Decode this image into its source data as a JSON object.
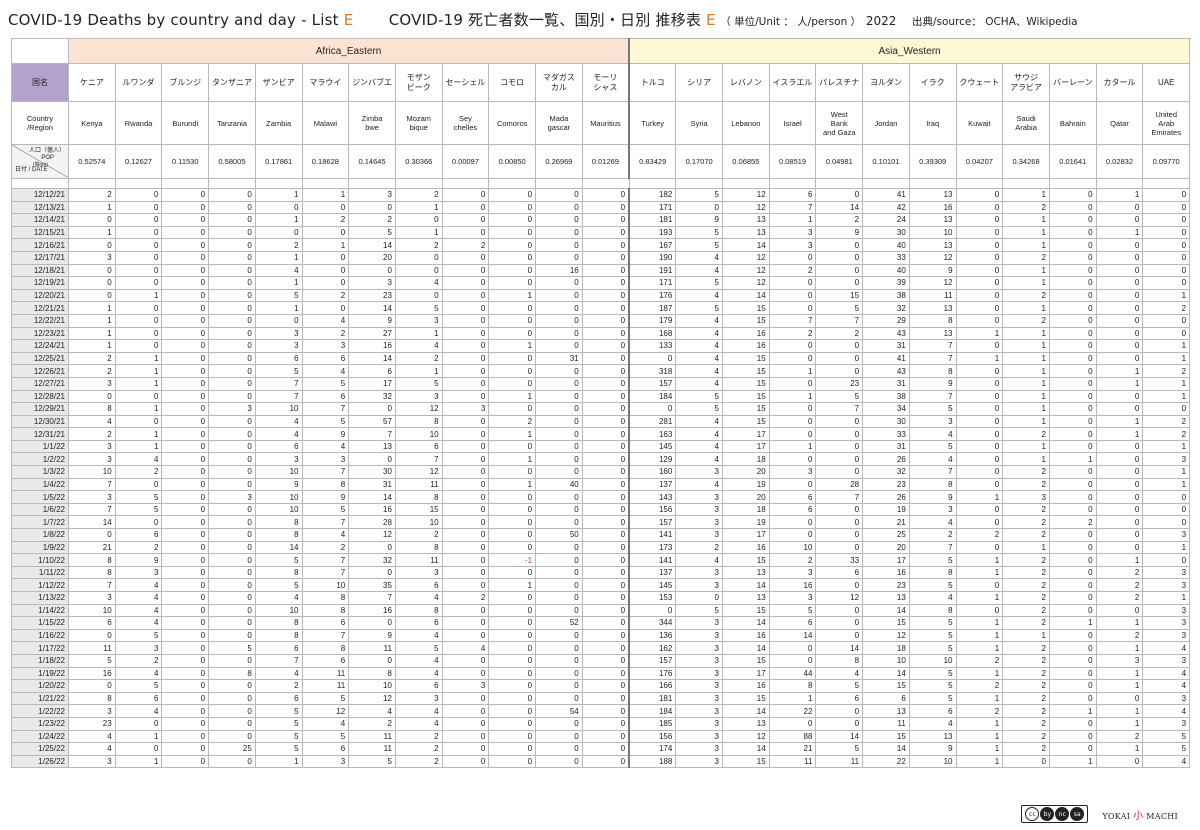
{
  "header": {
    "title_en_a": "COVID-19 Deaths by country and day - List ",
    "title_en_b": "E",
    "title_jp_a": "COVID-19  死亡者数一覧、国別・日別 推移表 ",
    "title_jp_b": "E",
    "unit": "（ 単位/Unit ： 人/person ）",
    "year": "2022",
    "source": "出典/source： OCHA、Wikipedia"
  },
  "regions": [
    {
      "name": "Africa_Eastern",
      "span": 12
    },
    {
      "name": "Asia_Western",
      "span": 13
    }
  ],
  "labels": {
    "country_jp": "国名",
    "country_en": "Country\n/Region",
    "pop_a": "人口（億人）",
    "pop_b": "POP",
    "pop_unit": "(億nm)",
    "date": "日付 / DATE"
  },
  "countries": [
    {
      "jp": "ケニア",
      "en": "Kenya",
      "pop": "0.52574"
    },
    {
      "jp": "ルワンダ",
      "en": "Rwanda",
      "pop": "0.12627"
    },
    {
      "jp": "ブルンジ",
      "en": "Burundi",
      "pop": "0.11530"
    },
    {
      "jp": "タンザニア",
      "en": "Tanzania",
      "pop": "0.58005"
    },
    {
      "jp": "ザンビア",
      "en": "Zambia",
      "pop": "0.17861"
    },
    {
      "jp": "マラウイ",
      "en": "Malawi",
      "pop": "0.18628"
    },
    {
      "jp": "ジンバブエ",
      "en": "Zimba\nbwe",
      "pop": "0.14645"
    },
    {
      "jp": "モザン\nビーク",
      "en": "Mozam\nbique",
      "pop": "0.30366"
    },
    {
      "jp": "セーシェル",
      "en": "Sey\nchelles",
      "pop": "0.00097"
    },
    {
      "jp": "コモロ",
      "en": "Comoros",
      "pop": "0.00850"
    },
    {
      "jp": "マダガス\nカル",
      "en": "Mada\ngascar",
      "pop": "0.26969"
    },
    {
      "jp": "モーリ\nシャス",
      "en": "Mauritius",
      "pop": "0.01269"
    },
    {
      "jp": "トルコ",
      "en": "Turkey",
      "pop": "0.83429"
    },
    {
      "jp": "シリア",
      "en": "Syria",
      "pop": "0.17070"
    },
    {
      "jp": "レバノン",
      "en": "Lebanon",
      "pop": "0.06855"
    },
    {
      "jp": "イスラエル",
      "en": "Israel",
      "pop": "0.08519"
    },
    {
      "jp": "パレスチナ",
      "en": "West\nBank\nand Gaza",
      "pop": "0.04981"
    },
    {
      "jp": "ヨルダン",
      "en": "Jordan",
      "pop": "0.10101"
    },
    {
      "jp": "イラク",
      "en": "Iraq",
      "pop": "0.39309"
    },
    {
      "jp": "クウェート",
      "en": "Kuwait",
      "pop": "0.04207"
    },
    {
      "jp": "サウジ\nアラビア",
      "en": "Saudi\nArabia",
      "pop": "0.34268"
    },
    {
      "jp": "バーレーン",
      "en": "Bahrain",
      "pop": "0.01641"
    },
    {
      "jp": "カタール",
      "en": "Qatar",
      "pop": "0.02832"
    },
    {
      "jp": "UAE",
      "en": "United\nArab\nEmirates",
      "pop": "0.09770"
    }
  ],
  "rows": [
    {
      "date": "12/12/21",
      "v": [
        2,
        0,
        0,
        0,
        1,
        1,
        3,
        2,
        0,
        0,
        0,
        0,
        182,
        5,
        12,
        6,
        0,
        41,
        13,
        0,
        1,
        0,
        1,
        0
      ]
    },
    {
      "date": "12/13/21",
      "v": [
        1,
        0,
        0,
        0,
        0,
        0,
        0,
        1,
        0,
        0,
        0,
        0,
        171,
        0,
        12,
        7,
        14,
        42,
        16,
        0,
        2,
        0,
        0,
        0
      ]
    },
    {
      "date": "12/14/21",
      "v": [
        0,
        0,
        0,
        0,
        1,
        2,
        2,
        0,
        0,
        0,
        0,
        0,
        181,
        9,
        13,
        1,
        2,
        24,
        13,
        0,
        1,
        0,
        0,
        0
      ]
    },
    {
      "date": "12/15/21",
      "v": [
        1,
        0,
        0,
        0,
        0,
        0,
        5,
        1,
        0,
        0,
        0,
        0,
        193,
        5,
        13,
        3,
        9,
        30,
        10,
        0,
        1,
        0,
        1,
        0
      ]
    },
    {
      "date": "12/16/21",
      "v": [
        0,
        0,
        0,
        0,
        2,
        1,
        14,
        2,
        2,
        0,
        0,
        0,
        167,
        5,
        14,
        3,
        0,
        40,
        13,
        0,
        1,
        0,
        0,
        0
      ]
    },
    {
      "date": "12/17/21",
      "v": [
        3,
        0,
        0,
        0,
        1,
        0,
        20,
        0,
        0,
        0,
        0,
        0,
        190,
        4,
        12,
        0,
        0,
        33,
        12,
        0,
        2,
        0,
        0,
        0
      ]
    },
    {
      "date": "12/18/21",
      "v": [
        0,
        0,
        0,
        0,
        4,
        0,
        0,
        0,
        0,
        0,
        16,
        0,
        191,
        4,
        12,
        2,
        0,
        40,
        9,
        0,
        1,
        0,
        0,
        0
      ]
    },
    {
      "date": "12/19/21",
      "v": [
        0,
        0,
        0,
        0,
        1,
        0,
        3,
        4,
        0,
        0,
        0,
        0,
        171,
        5,
        12,
        0,
        0,
        39,
        12,
        0,
        1,
        0,
        0,
        0
      ]
    },
    {
      "date": "12/20/21",
      "v": [
        0,
        1,
        0,
        0,
        5,
        2,
        23,
        0,
        0,
        1,
        0,
        0,
        176,
        4,
        14,
        0,
        15,
        38,
        11,
        0,
        2,
        0,
        0,
        1
      ]
    },
    {
      "date": "12/21/21",
      "v": [
        1,
        0,
        0,
        0,
        1,
        0,
        14,
        5,
        0,
        0,
        0,
        0,
        187,
        5,
        15,
        0,
        5,
        32,
        13,
        0,
        1,
        0,
        0,
        2
      ]
    },
    {
      "date": "12/22/21",
      "v": [
        1,
        0,
        0,
        0,
        0,
        4,
        9,
        3,
        0,
        0,
        0,
        0,
        179,
        4,
        15,
        7,
        7,
        29,
        8,
        0,
        2,
        0,
        0,
        0
      ]
    },
    {
      "date": "12/23/21",
      "v": [
        1,
        0,
        0,
        0,
        3,
        2,
        27,
        1,
        0,
        0,
        0,
        0,
        168,
        4,
        16,
        2,
        2,
        43,
        13,
        1,
        1,
        0,
        0,
        0
      ]
    },
    {
      "date": "12/24/21",
      "v": [
        1,
        0,
        0,
        0,
        3,
        3,
        16,
        4,
        0,
        1,
        0,
        0,
        133,
        4,
        16,
        0,
        0,
        31,
        7,
        0,
        1,
        0,
        0,
        1
      ]
    },
    {
      "date": "12/25/21",
      "v": [
        2,
        1,
        0,
        0,
        6,
        6,
        14,
        2,
        0,
        0,
        31,
        0,
        0,
        4,
        15,
        0,
        0,
        41,
        7,
        1,
        1,
        0,
        0,
        1
      ]
    },
    {
      "date": "12/26/21",
      "v": [
        2,
        1,
        0,
        0,
        5,
        4,
        6,
        1,
        0,
        0,
        0,
        0,
        318,
        4,
        15,
        1,
        0,
        43,
        8,
        0,
        1,
        0,
        1,
        2
      ]
    },
    {
      "date": "12/27/21",
      "v": [
        3,
        1,
        0,
        0,
        7,
        5,
        17,
        5,
        0,
        0,
        0,
        0,
        157,
        4,
        15,
        0,
        23,
        31,
        9,
        0,
        1,
        0,
        1,
        1
      ]
    },
    {
      "date": "12/28/21",
      "v": [
        0,
        0,
        0,
        0,
        7,
        6,
        32,
        3,
        0,
        1,
        0,
        0,
        184,
        5,
        15,
        1,
        5,
        38,
        7,
        0,
        1,
        0,
        0,
        1
      ]
    },
    {
      "date": "12/29/21",
      "v": [
        8,
        1,
        0,
        3,
        10,
        7,
        0,
        12,
        3,
        0,
        0,
        0,
        0,
        5,
        15,
        0,
        7,
        34,
        5,
        0,
        1,
        0,
        0,
        0
      ]
    },
    {
      "date": "12/30/21",
      "v": [
        4,
        0,
        0,
        0,
        4,
        5,
        57,
        8,
        0,
        2,
        0,
        0,
        281,
        4,
        15,
        0,
        0,
        30,
        3,
        0,
        1,
        0,
        1,
        2
      ]
    },
    {
      "date": "12/31/21",
      "v": [
        2,
        1,
        0,
        0,
        4,
        9,
        7,
        10,
        0,
        1,
        0,
        0,
        163,
        4,
        17,
        0,
        0,
        33,
        4,
        0,
        2,
        0,
        1,
        2
      ]
    },
    {
      "date": "1/1/22",
      "v": [
        3,
        1,
        0,
        0,
        6,
        4,
        13,
        6,
        0,
        0,
        0,
        0,
        145,
        4,
        17,
        1,
        0,
        31,
        5,
        0,
        1,
        0,
        0,
        1
      ]
    },
    {
      "date": "1/2/22",
      "v": [
        3,
        4,
        0,
        0,
        3,
        3,
        0,
        7,
        0,
        1,
        0,
        0,
        129,
        4,
        18,
        0,
        0,
        26,
        4,
        0,
        1,
        1,
        0,
        3
      ]
    },
    {
      "date": "1/3/22",
      "v": [
        10,
        2,
        0,
        0,
        10,
        7,
        30,
        12,
        0,
        0,
        0,
        0,
        160,
        3,
        20,
        3,
        0,
        32,
        7,
        0,
        2,
        0,
        0,
        1
      ]
    },
    {
      "date": "1/4/22",
      "v": [
        7,
        0,
        0,
        0,
        9,
        8,
        31,
        11,
        0,
        1,
        40,
        0,
        137,
        4,
        19,
        0,
        28,
        23,
        8,
        0,
        2,
        0,
        0,
        1
      ]
    },
    {
      "date": "1/5/22",
      "v": [
        3,
        5,
        0,
        3,
        10,
        9,
        14,
        8,
        0,
        0,
        0,
        0,
        143,
        3,
        20,
        6,
        7,
        26,
        9,
        1,
        3,
        0,
        0,
        0
      ]
    },
    {
      "date": "1/6/22",
      "v": [
        7,
        5,
        0,
        0,
        10,
        5,
        16,
        15,
        0,
        0,
        0,
        0,
        156,
        3,
        18,
        6,
        0,
        19,
        3,
        0,
        2,
        0,
        0,
        0
      ]
    },
    {
      "date": "1/7/22",
      "v": [
        14,
        0,
        0,
        0,
        8,
        7,
        28,
        10,
        0,
        0,
        0,
        0,
        157,
        3,
        19,
        0,
        0,
        21,
        4,
        0,
        2,
        2,
        0,
        0
      ]
    },
    {
      "date": "1/8/22",
      "v": [
        0,
        6,
        0,
        0,
        8,
        4,
        12,
        2,
        0,
        0,
        50,
        0,
        141,
        3,
        17,
        0,
        0,
        25,
        2,
        2,
        2,
        0,
        0,
        3
      ]
    },
    {
      "date": "1/9/22",
      "v": [
        21,
        2,
        0,
        0,
        14,
        2,
        0,
        8,
        0,
        0,
        0,
        0,
        173,
        2,
        16,
        10,
        0,
        20,
        7,
        0,
        1,
        0,
        0,
        1
      ]
    },
    {
      "date": "1/10/22",
      "v": [
        8,
        9,
        0,
        0,
        5,
        7,
        32,
        11,
        0,
        -1,
        0,
        0,
        141,
        4,
        15,
        2,
        33,
        17,
        5,
        1,
        2,
        0,
        1,
        0
      ]
    },
    {
      "date": "1/11/22",
      "v": [
        8,
        3,
        0,
        0,
        8,
        7,
        0,
        3,
        0,
        0,
        0,
        0,
        137,
        3,
        13,
        3,
        6,
        16,
        8,
        1,
        2,
        0,
        2,
        3
      ]
    },
    {
      "date": "1/12/22",
      "v": [
        7,
        4,
        0,
        0,
        5,
        10,
        35,
        6,
        0,
        1,
        0,
        0,
        145,
        3,
        14,
        16,
        0,
        23,
        5,
        0,
        2,
        0,
        2,
        3
      ]
    },
    {
      "date": "1/13/22",
      "v": [
        3,
        4,
        0,
        0,
        4,
        8,
        7,
        4,
        2,
        0,
        0,
        0,
        153,
        0,
        13,
        3,
        12,
        13,
        4,
        1,
        2,
        0,
        2,
        1
      ]
    },
    {
      "date": "1/14/22",
      "v": [
        10,
        4,
        0,
        0,
        10,
        8,
        16,
        8,
        0,
        0,
        0,
        0,
        0,
        5,
        15,
        5,
        0,
        14,
        8,
        0,
        2,
        0,
        0,
        3
      ]
    },
    {
      "date": "1/15/22",
      "v": [
        6,
        4,
        0,
        0,
        8,
        6,
        0,
        6,
        0,
        0,
        52,
        0,
        344,
        3,
        14,
        6,
        0,
        15,
        5,
        1,
        2,
        1,
        1,
        3
      ]
    },
    {
      "date": "1/16/22",
      "v": [
        0,
        5,
        0,
        0,
        8,
        7,
        9,
        4,
        0,
        0,
        0,
        0,
        136,
        3,
        16,
        14,
        0,
        12,
        5,
        1,
        1,
        0,
        2,
        3
      ]
    },
    {
      "date": "1/17/22",
      "v": [
        11,
        3,
        0,
        5,
        6,
        8,
        11,
        5,
        4,
        0,
        0,
        0,
        162,
        3,
        14,
        0,
        14,
        18,
        5,
        1,
        2,
        0,
        1,
        4
      ]
    },
    {
      "date": "1/18/22",
      "v": [
        5,
        2,
        0,
        0,
        7,
        6,
        0,
        4,
        0,
        0,
        0,
        0,
        157,
        3,
        15,
        0,
        8,
        10,
        10,
        2,
        2,
        0,
        3,
        3
      ]
    },
    {
      "date": "1/19/22",
      "v": [
        16,
        4,
        0,
        8,
        4,
        11,
        8,
        4,
        0,
        0,
        0,
        0,
        176,
        3,
        17,
        44,
        4,
        14,
        5,
        1,
        2,
        0,
        1,
        4
      ]
    },
    {
      "date": "1/20/22",
      "v": [
        0,
        5,
        0,
        0,
        2,
        11,
        10,
        6,
        3,
        0,
        0,
        0,
        166,
        3,
        16,
        8,
        5,
        15,
        5,
        2,
        2,
        0,
        1,
        4
      ]
    },
    {
      "date": "1/21/22",
      "v": [
        8,
        6,
        0,
        0,
        6,
        5,
        12,
        3,
        0,
        0,
        0,
        0,
        181,
        3,
        15,
        1,
        6,
        6,
        5,
        1,
        2,
        0,
        0,
        3
      ]
    },
    {
      "date": "1/22/22",
      "v": [
        3,
        4,
        0,
        0,
        5,
        12,
        4,
        4,
        0,
        0,
        54,
        0,
        184,
        3,
        14,
        22,
        0,
        13,
        6,
        2,
        2,
        1,
        1,
        4
      ]
    },
    {
      "date": "1/23/22",
      "v": [
        23,
        0,
        0,
        0,
        5,
        4,
        2,
        4,
        0,
        0,
        0,
        0,
        185,
        3,
        13,
        0,
        0,
        11,
        4,
        1,
        2,
        0,
        1,
        3
      ]
    },
    {
      "date": "1/24/22",
      "v": [
        4,
        1,
        0,
        0,
        5,
        5,
        11,
        2,
        0,
        0,
        0,
        0,
        156,
        3,
        12,
        88,
        14,
        15,
        13,
        1,
        2,
        0,
        2,
        5
      ]
    },
    {
      "date": "1/25/22",
      "v": [
        4,
        0,
        0,
        25,
        5,
        6,
        11,
        2,
        0,
        0,
        0,
        0,
        174,
        3,
        14,
        21,
        5,
        14,
        9,
        1,
        2,
        0,
        1,
        5
      ]
    },
    {
      "date": "1/26/22",
      "v": [
        3,
        1,
        0,
        0,
        1,
        3,
        5,
        2,
        0,
        0,
        0,
        0,
        188,
        3,
        15,
        11,
        11,
        22,
        10,
        1,
        0,
        1,
        0,
        4
      ]
    }
  ],
  "footer": {
    "license": [
      "cc",
      "by",
      "nc",
      "sa"
    ],
    "logo_a": "YOKAI",
    "logo_b": "小",
    "logo_c": "MACHI"
  }
}
